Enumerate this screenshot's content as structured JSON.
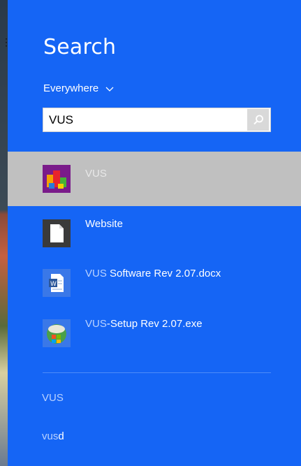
{
  "search": {
    "title": "Search",
    "scope": "Everywhere",
    "query": "VUS"
  },
  "results": [
    {
      "highlight": "VUS",
      "rest": "",
      "icon": "vus-app-icon",
      "selected": true
    },
    {
      "highlight": "",
      "rest": "Website",
      "icon": "blank-file-icon",
      "selected": false
    },
    {
      "highlight": "VUS",
      "rest": " Software Rev 2.07.docx",
      "icon": "word-document-icon",
      "selected": false
    },
    {
      "highlight": "VUS",
      "rest": "-Setup Rev 2.07.exe",
      "icon": "setup-installer-icon",
      "selected": false
    }
  ],
  "suggestions": [
    {
      "highlight": "VUS",
      "rest": ""
    },
    {
      "highlight": "vus",
      "rest": "d"
    }
  ],
  "colors": {
    "panel": "#1565f5",
    "selected_row": "#c0c0c0",
    "match_text": "#b9d2ff"
  }
}
